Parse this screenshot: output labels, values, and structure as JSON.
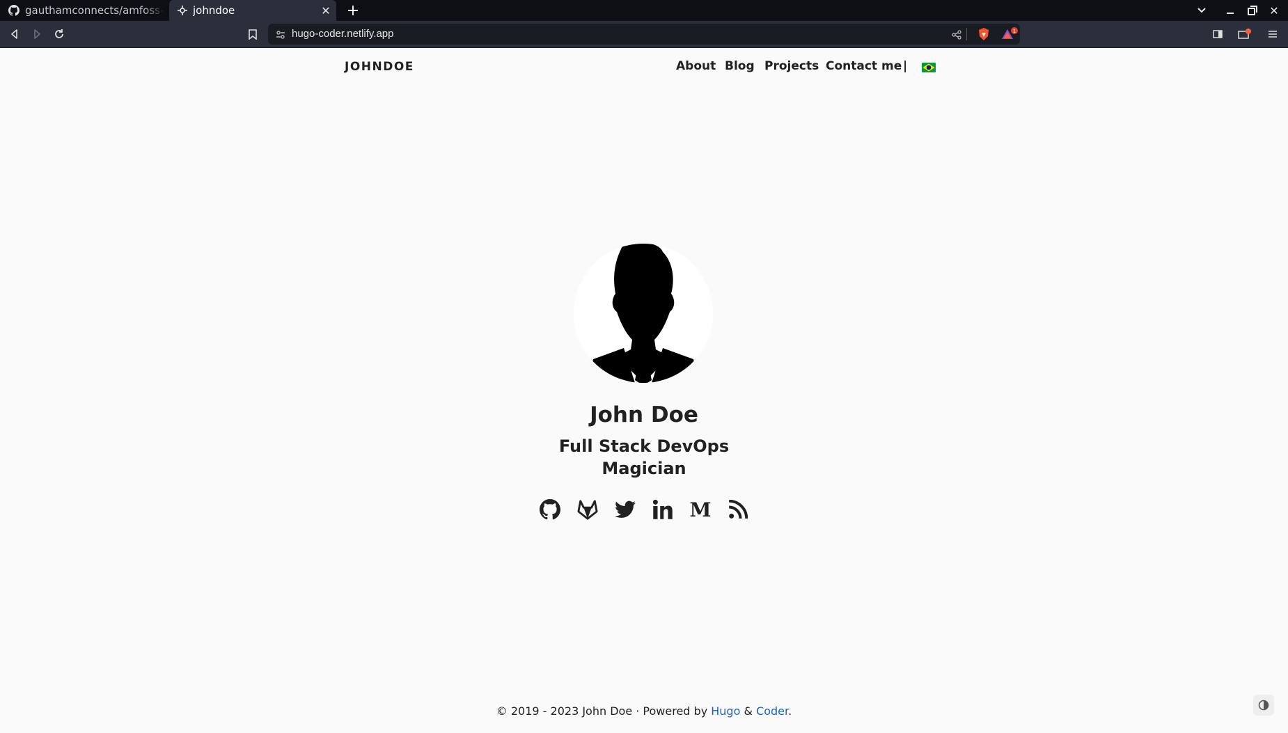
{
  "browser": {
    "tabs": [
      {
        "title": "gauthamconnects/amfoss-ta",
        "icon": "github-icon",
        "active": false
      },
      {
        "title": "johndoe",
        "icon": "site-icon",
        "active": true
      }
    ],
    "url": "hugo-coder.netlify.app"
  },
  "site": {
    "brand": "JOHNDOE",
    "nav": [
      "About",
      "Blog",
      "Projects",
      "Contact me"
    ],
    "separator": "|",
    "language_flag": "brazil-flag-icon"
  },
  "profile": {
    "name": "John Doe",
    "tagline_line1": "Full Stack DevOps",
    "tagline_line2": "Magician",
    "socials": [
      "github-icon",
      "gitlab-icon",
      "twitter-icon",
      "linkedin-icon",
      "medium-icon",
      "rss-icon"
    ]
  },
  "footer": {
    "prefix": "© 2019 - 2023 John Doe · Powered by ",
    "link1": "Hugo",
    "amp": " & ",
    "link2": "Coder",
    "suffix": "."
  },
  "colors": {
    "page_bg": "#fafafa",
    "text": "#212121",
    "link": "#1565c0",
    "tabbar_bg": "#0e0f14",
    "toolbar_bg": "#2b2e3b"
  }
}
